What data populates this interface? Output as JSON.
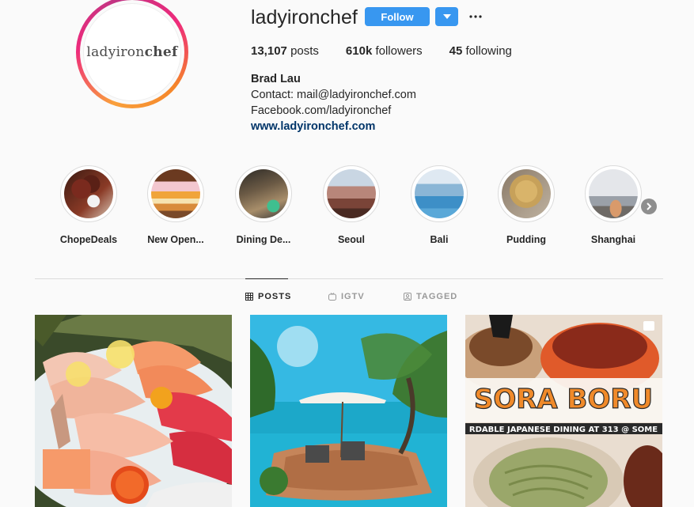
{
  "profile": {
    "avatar_logo_left": "ladyiron",
    "avatar_logo_right": "chef",
    "username": "ladyironchef",
    "follow_label": "Follow",
    "more_label": "···",
    "stats": {
      "posts_count": "13,107",
      "posts_label": "posts",
      "followers_count": "610k",
      "followers_label": "followers",
      "following_count": "45",
      "following_label": "following"
    },
    "bio": {
      "name": "Brad Lau",
      "line1": "Contact: mail@ladyironchef.com",
      "line2": "Facebook.com/ladyironchef",
      "link": "www.ladyironchef.com"
    }
  },
  "highlights": [
    {
      "label": "ChopeDeals"
    },
    {
      "label": "New Open..."
    },
    {
      "label": "Dining De..."
    },
    {
      "label": "Seoul"
    },
    {
      "label": "Bali"
    },
    {
      "label": "Pudding"
    },
    {
      "label": "Shanghai"
    }
  ],
  "tabs": {
    "posts": "POSTS",
    "igtv": "IGTV",
    "tagged": "TAGGED"
  },
  "posts": [
    {
      "id": "sashimi",
      "overlay_text": ""
    },
    {
      "id": "bali-pool",
      "overlay_text": ""
    },
    {
      "id": "sora-boru",
      "overlay_title": "SORA BORU",
      "overlay_subtitle": "RDABLE JAPANESE DINING AT 313 @ SOME"
    }
  ],
  "colors": {
    "follow_blue": "#3897f0",
    "link_blue": "#003569",
    "background": "#fafafa",
    "divider": "#dbdbdb"
  }
}
